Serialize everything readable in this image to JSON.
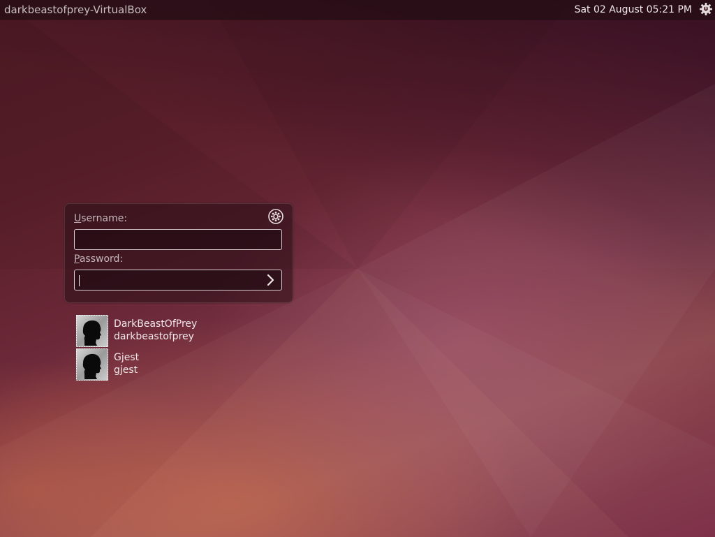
{
  "topbar": {
    "hostname": "darkbeastofprey-VirtualBox",
    "datetime": "Sat 02 August 05:21 PM",
    "power_icon": "power-icon"
  },
  "login": {
    "username_label_accel": "U",
    "username_label_rest": "sername:",
    "username_value": "",
    "password_label_accel": "P",
    "password_label_rest": "assword:",
    "password_value": "",
    "settings_icon": "gear-icon",
    "submit_icon": "chevron-right-icon"
  },
  "users": [
    {
      "display_name": "DarkBeastOfPrey",
      "login": "darkbeastofprey",
      "avatar_icon": "user-silhouette-icon"
    },
    {
      "display_name": "Gjest",
      "login": "gjest",
      "avatar_icon": "user-silhouette-icon"
    }
  ],
  "colors": {
    "panel_bg": "#230c14",
    "text": "#f1e8ea",
    "label": "#c6b7bb"
  }
}
